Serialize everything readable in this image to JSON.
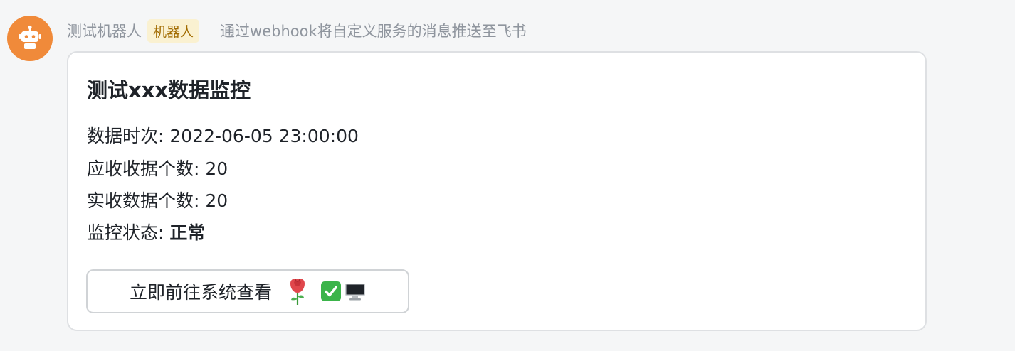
{
  "message": {
    "sender_name": "测试机器人",
    "sender_tag": "机器人",
    "sender_desc": "通过webhook将自定义服务的消息推送至飞书",
    "avatar_icon": "robot-icon",
    "accent_color": "#f08a3a"
  },
  "card": {
    "title": "测试xxx数据监控",
    "fields": [
      {
        "label": "数据时次: ",
        "value": "2022-06-05 23:00:00"
      },
      {
        "label": "应收收据个数: ",
        "value": "20"
      },
      {
        "label": "实收数据个数: ",
        "value": "20"
      },
      {
        "label": "监控状态: ",
        "value": "正常"
      }
    ],
    "button": {
      "label": "立即前往系统查看",
      "icons": [
        "rose-icon",
        "check-mark-icon",
        "desktop-computer-icon"
      ]
    }
  }
}
